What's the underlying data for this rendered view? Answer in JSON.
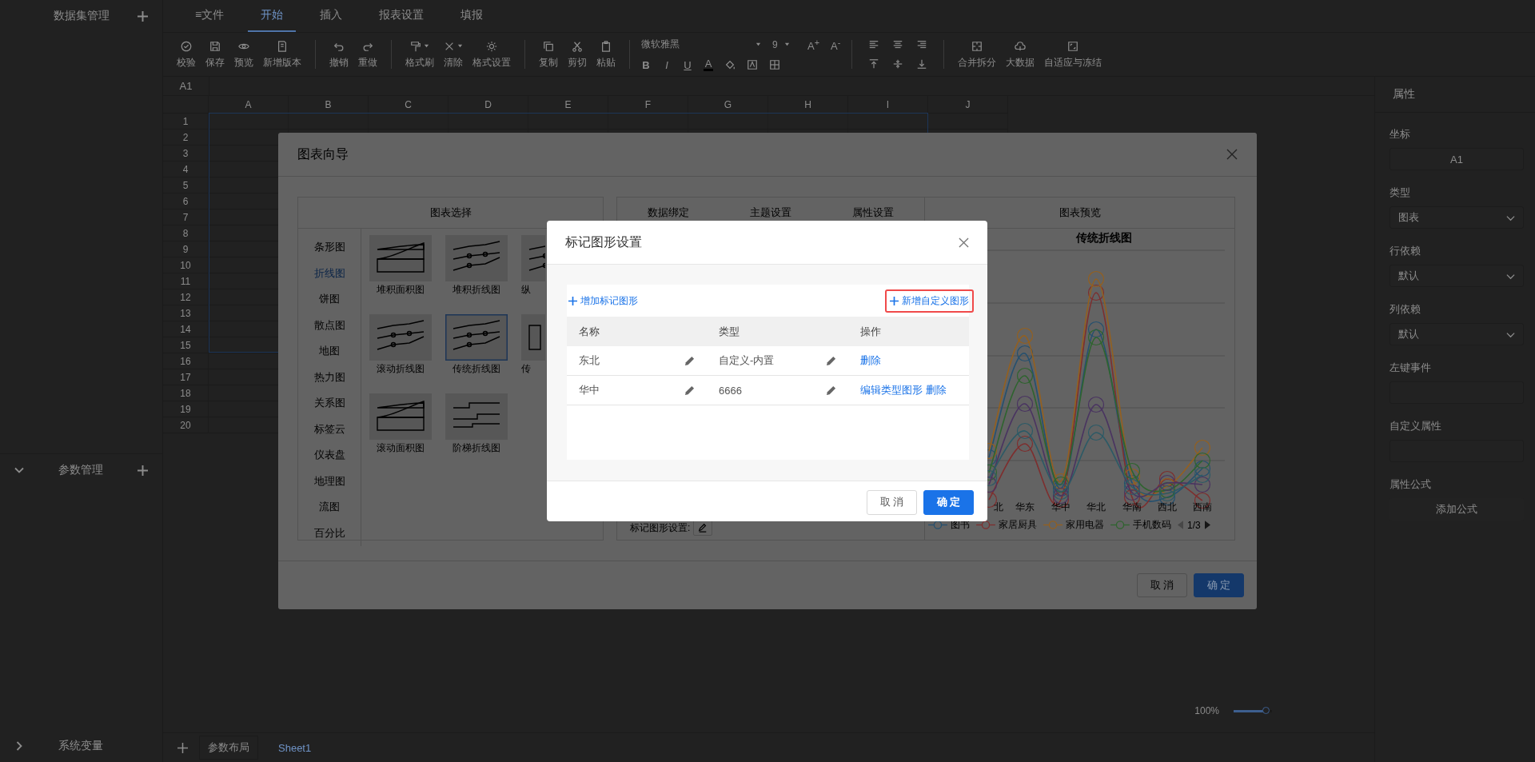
{
  "sidebar": [
    {
      "kind": "header",
      "title": "数据集管理",
      "add_button": true
    },
    {
      "kind": "collapsible",
      "title": "参数管理",
      "expanded": true,
      "add_button": true
    },
    {
      "kind": "collapsible",
      "title": "系统变量",
      "expanded": false
    }
  ],
  "menu_tabs": [
    {
      "icon": "≡",
      "label": "文件",
      "selected": false
    },
    {
      "label": "开始",
      "selected": true
    },
    {
      "label": "插入",
      "selected": false
    },
    {
      "label": "报表设置",
      "selected": false
    },
    {
      "label": "填报",
      "selected": false
    }
  ],
  "toolbar": {
    "buttons": [
      {
        "kind": "check",
        "label": "校验"
      },
      {
        "kind": "save",
        "label": "保存"
      },
      {
        "kind": "eye",
        "label": "预览"
      },
      {
        "kind": "doc",
        "label": "新增版本"
      },
      {
        "kind": "undo",
        "label": "撤销",
        "group_start": true
      },
      {
        "kind": "redo",
        "label": "重做"
      },
      {
        "kind": "brush",
        "label": "格式刷",
        "group_start": true,
        "dropdown": true
      },
      {
        "kind": "clear",
        "label": "清除",
        "dropdown": true
      },
      {
        "kind": "gear",
        "label": "格式设置"
      },
      {
        "kind": "copy",
        "label": "复制",
        "group_start": true
      },
      {
        "kind": "cut",
        "label": "剪切"
      },
      {
        "kind": "paste",
        "label": "粘贴"
      }
    ],
    "font": {
      "family": "微软雅黑",
      "size": "9",
      "grow": "A$^{+}$",
      "shrink": "A$^{-}$",
      "styles": [
        "B",
        "I",
        "U",
        "A"
      ]
    },
    "layout_buttons": [
      {
        "kind": "merge",
        "label": "合并拆分"
      },
      {
        "kind": "cloud",
        "label": "大数据"
      },
      {
        "kind": "frame",
        "label": "自适应与冻结"
      }
    ]
  },
  "sheet": {
    "cell_ref": "A1",
    "columns": [
      "A",
      "B",
      "C",
      "D",
      "E",
      "F",
      "G",
      "H",
      "I",
      "J"
    ],
    "rows": [
      "1",
      "2",
      "3",
      "4",
      "5",
      "6",
      "7",
      "8",
      "9",
      "10",
      "11",
      "12",
      "13",
      "14",
      "15",
      "16",
      "17",
      "18",
      "19",
      "20"
    ]
  },
  "zoom": {
    "reading": "100%",
    "level": 0.85
  },
  "sheet_tabs": [
    {
      "label": "参数布局",
      "selected": false
    },
    {
      "label": "Sheet1",
      "selected": true
    }
  ],
  "properties": {
    "title": "属性",
    "fields": [
      {
        "kind": "readonly",
        "label": "坐标",
        "value": "A1"
      },
      {
        "kind": "select",
        "label": "类型",
        "value": "图表"
      },
      {
        "kind": "select",
        "label": "行依赖",
        "value": "默认"
      },
      {
        "kind": "select",
        "label": "列依赖",
        "value": "默认"
      },
      {
        "kind": "input",
        "label": "左键事件"
      },
      {
        "kind": "input",
        "label": "自定义属性"
      },
      {
        "kind": "button",
        "label": "属性公式",
        "value": "添加公式"
      }
    ]
  },
  "chart_wizard": {
    "title": "图表向导",
    "selector": {
      "title": "图表选择",
      "types": [
        {
          "label": "条形图",
          "selected": false
        },
        {
          "label": "折线图",
          "selected": true
        },
        {
          "label": "饼图",
          "selected": false
        },
        {
          "label": "散点图",
          "selected": false
        },
        {
          "label": "地图",
          "selected": false
        },
        {
          "label": "热力图",
          "selected": false
        },
        {
          "label": "关系图",
          "selected": false
        },
        {
          "label": "标签云",
          "selected": false
        },
        {
          "label": "仪表盘",
          "selected": false
        },
        {
          "label": "地理图",
          "selected": false
        },
        {
          "label": "流图",
          "selected": false
        },
        {
          "label": "百分比",
          "selected": false
        }
      ],
      "templates": [
        {
          "kind": "stacked-area",
          "label": "堆积面积图",
          "selected": false
        },
        {
          "kind": "stacked-line",
          "label": "堆积折线图",
          "selected": false
        },
        {
          "kind": "vertical-line",
          "label": "纵",
          "selected": false
        },
        {
          "kind": "scroll-line",
          "label": "滚动折线图",
          "selected": false
        },
        {
          "kind": "line",
          "label": "传统折线图",
          "selected": true
        },
        {
          "kind": "bar-line",
          "label": "传",
          "selected": false
        },
        {
          "kind": "scroll-area",
          "label": "滚动面积图",
          "selected": false
        },
        {
          "kind": "step-line",
          "label": "阶梯折线图",
          "selected": false
        }
      ]
    },
    "settings_tabs": [
      "数据绑定",
      "主题设置",
      "属性设置"
    ],
    "marker_setting_label": "标记图形设置:",
    "preview": {
      "title": "图表预览",
      "chart_title": "传统折线图",
      "categories": [
        "北",
        "华东",
        "华中",
        "华北",
        "华南",
        "西北",
        "西南"
      ],
      "legend": [
        {
          "name": "图书",
          "color": "#25506f"
        },
        {
          "name": "家居厨具",
          "color": "#7e2e2e"
        },
        {
          "name": "家用电器",
          "color": "#94601f"
        },
        {
          "name": "手机数码",
          "color": "#2e642e"
        }
      ],
      "legend_page": "1/3"
    },
    "buttons": [
      {
        "label": "取 消",
        "primary": false
      },
      {
        "label": "确 定",
        "primary": true
      }
    ]
  },
  "marker_dialog": {
    "title": "标记图形设置",
    "add_marker": "增加标记图形",
    "add_custom": "新增自定义图形",
    "add_custom_highlighted": true,
    "columns": [
      "名称",
      "类型",
      "操作"
    ],
    "rows": [
      {
        "name": "东北",
        "type": "自定义-内置",
        "actions": [
          "删除"
        ]
      },
      {
        "name": "华中",
        "type": "6666",
        "actions": [
          "编辑类型图形",
          "删除"
        ]
      }
    ],
    "buttons": [
      {
        "label": "取 消",
        "primary": false
      },
      {
        "label": "确 定",
        "primary": true
      }
    ]
  }
}
